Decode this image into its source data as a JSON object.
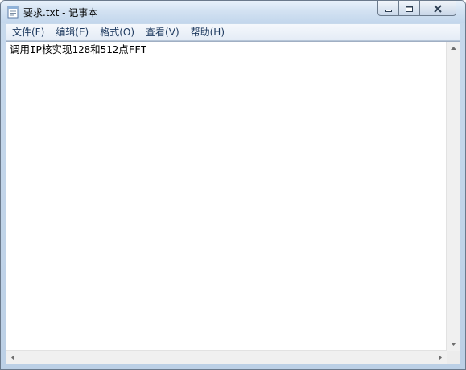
{
  "window": {
    "title": "要求.txt - 记事本",
    "icons": {
      "app": "notepad-icon",
      "minimize": "minimize-icon",
      "maximize": "restore-icon",
      "close": "close-icon"
    }
  },
  "menu": {
    "items": [
      {
        "label": "文件(F)"
      },
      {
        "label": "编辑(E)"
      },
      {
        "label": "格式(O)"
      },
      {
        "label": "查看(V)"
      },
      {
        "label": "帮助(H)"
      }
    ]
  },
  "editor": {
    "content": "调用IP核实现128和512点FFT"
  },
  "scrollbars": {
    "icons": [
      "scroll-up-arrow-icon",
      "scroll-down-arrow-icon",
      "scroll-left-arrow-icon",
      "scroll-right-arrow-icon"
    ]
  }
}
